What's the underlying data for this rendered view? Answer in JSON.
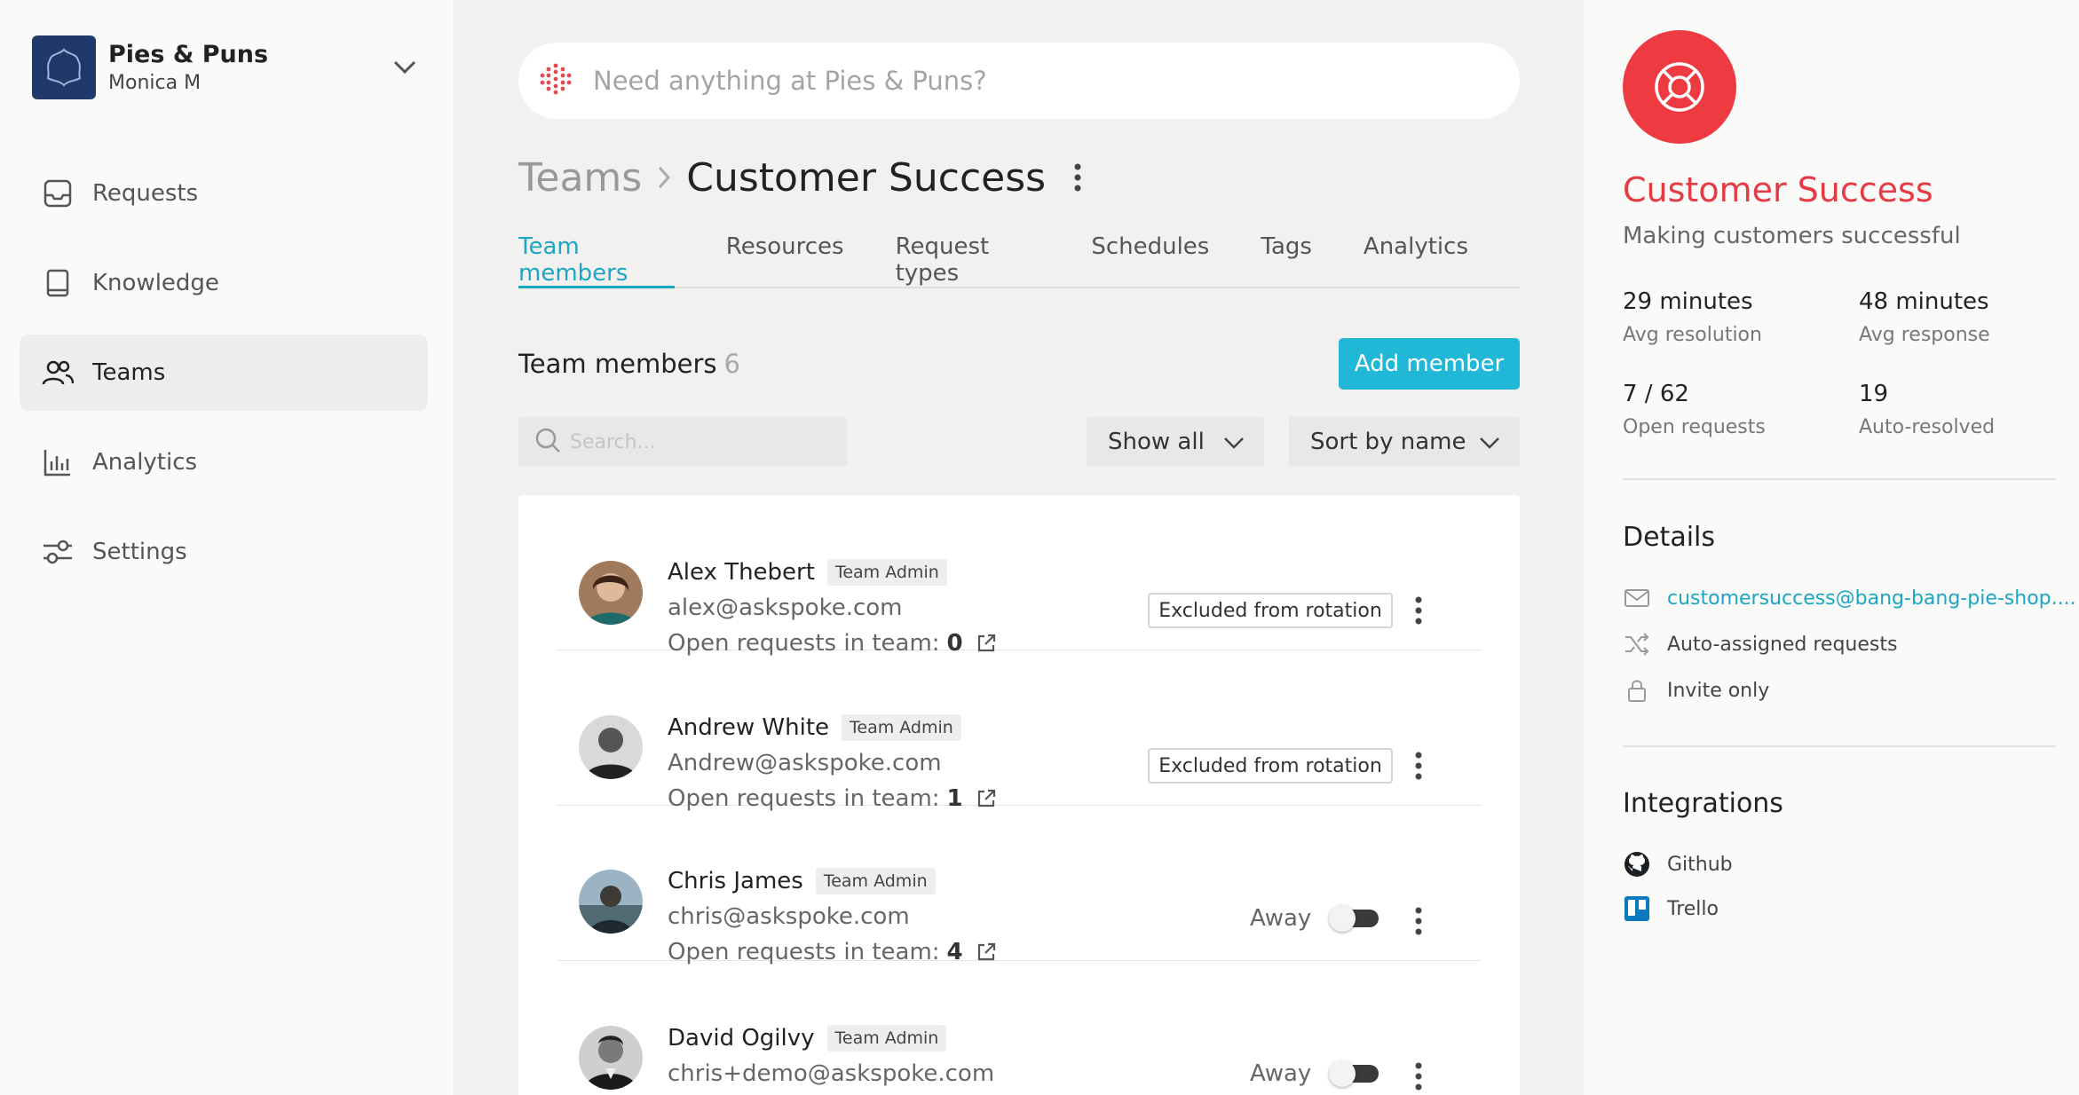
{
  "sidebar": {
    "org_name": "Pies & Puns",
    "user_name": "Monica M",
    "items": [
      {
        "label": "Requests",
        "icon": "inbox-icon"
      },
      {
        "label": "Knowledge",
        "icon": "book-icon"
      },
      {
        "label": "Teams",
        "icon": "users-icon",
        "active": true
      },
      {
        "label": "Analytics",
        "icon": "bar-chart-icon"
      },
      {
        "label": "Settings",
        "icon": "sliders-icon"
      }
    ]
  },
  "main": {
    "search_placeholder": "Need anything at Pies & Puns?",
    "breadcrumb_parent": "Teams",
    "breadcrumb_current": "Customer Success",
    "tabs": [
      "Team members",
      "Resources",
      "Request types",
      "Schedules",
      "Tags",
      "Analytics"
    ],
    "members_title": "Team members",
    "members_count": "6",
    "add_member_label": "Add member",
    "member_search_placeholder": "Search...",
    "filter_show": "Show all",
    "filter_sort": "Sort by name",
    "open_requests_label": "Open requests in team:",
    "members": [
      {
        "name": "Alex Thebert",
        "role": "Team Admin",
        "email": "alex@askspoke.com",
        "open_requests": "0",
        "status": "Excluded from rotation"
      },
      {
        "name": "Andrew White",
        "role": "Team Admin",
        "email": "Andrew@askspoke.com",
        "open_requests": "1",
        "status": "Excluded from rotation"
      },
      {
        "name": "Chris James",
        "role": "Team Admin",
        "email": "chris@askspoke.com",
        "open_requests": "4",
        "status": "Away"
      },
      {
        "name": "David Ogilvy",
        "role": "Team Admin",
        "email": "chris+demo@askspoke.com",
        "status": "Away"
      }
    ]
  },
  "team_panel": {
    "name": "Customer Success",
    "description": "Making customers successful",
    "stats": [
      {
        "value": "29 minutes",
        "label": "Avg resolution"
      },
      {
        "value": "48 minutes",
        "label": "Avg response"
      },
      {
        "value": "7 / 62",
        "label": "Open requests"
      },
      {
        "value": "19",
        "label": "Auto-resolved"
      }
    ],
    "details_title": "Details",
    "details": {
      "email": "customersuccess@bang-bang-pie-shop....",
      "assignment": "Auto-assigned requests",
      "access": "Invite only"
    },
    "integrations_title": "Integrations",
    "integrations": [
      "Github",
      "Trello"
    ]
  },
  "colors": {
    "accent": "#21b7d6",
    "team_red": "#ee3b42",
    "org_navy": "#1f3a6a"
  }
}
